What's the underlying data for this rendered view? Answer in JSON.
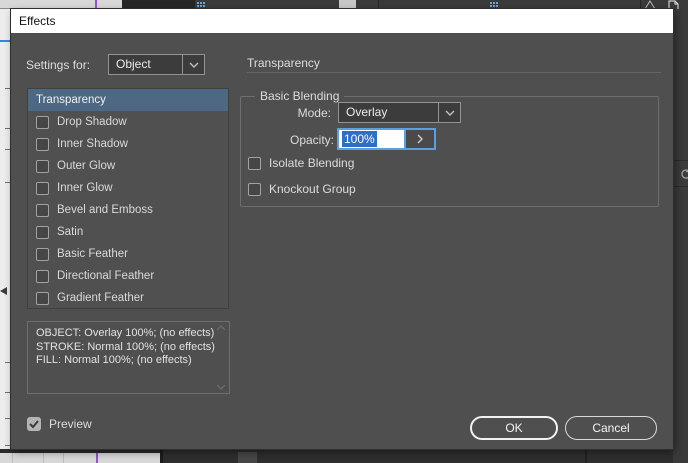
{
  "window": {
    "title": "Effects"
  },
  "settings_for": {
    "label": "Settings for:",
    "value": "Object"
  },
  "effects_list": {
    "items": [
      {
        "label": "Transparency",
        "selected": true,
        "has_checkbox": false,
        "checked": false
      },
      {
        "label": "Drop Shadow",
        "selected": false,
        "has_checkbox": true,
        "checked": false
      },
      {
        "label": "Inner Shadow",
        "selected": false,
        "has_checkbox": true,
        "checked": false
      },
      {
        "label": "Outer Glow",
        "selected": false,
        "has_checkbox": true,
        "checked": false
      },
      {
        "label": "Inner Glow",
        "selected": false,
        "has_checkbox": true,
        "checked": false
      },
      {
        "label": "Bevel and Emboss",
        "selected": false,
        "has_checkbox": true,
        "checked": false
      },
      {
        "label": "Satin",
        "selected": false,
        "has_checkbox": true,
        "checked": false
      },
      {
        "label": "Basic Feather",
        "selected": false,
        "has_checkbox": true,
        "checked": false
      },
      {
        "label": "Directional Feather",
        "selected": false,
        "has_checkbox": true,
        "checked": false
      },
      {
        "label": "Gradient Feather",
        "selected": false,
        "has_checkbox": true,
        "checked": false
      }
    ]
  },
  "summary": {
    "lines": [
      "OBJECT: Overlay 100%; (no effects)",
      "STROKE: Normal 100%; (no effects)",
      "FILL: Normal 100%; (no effects)"
    ]
  },
  "preview": {
    "label": "Preview",
    "checked": true
  },
  "panel": {
    "heading": "Transparency",
    "group_title": "Basic Blending",
    "mode": {
      "label": "Mode:",
      "value": "Overlay"
    },
    "opacity": {
      "label": "Opacity:",
      "value": "100%"
    },
    "isolate_blending_label": "Isolate Blending",
    "knockout_group_label": "Knockout Group"
  },
  "buttons": {
    "ok": "OK",
    "cancel": "Cancel"
  },
  "colors": {
    "dialog_bg": "#4f4f4f",
    "titlebar_bg": "#ffffff",
    "selected_row": "#4c6883",
    "opacity_selection": "#2e6ec4",
    "focus_border": "#58a0e2",
    "guide_purple": "#9a4fd2",
    "guide_blue": "#3b82e0"
  }
}
